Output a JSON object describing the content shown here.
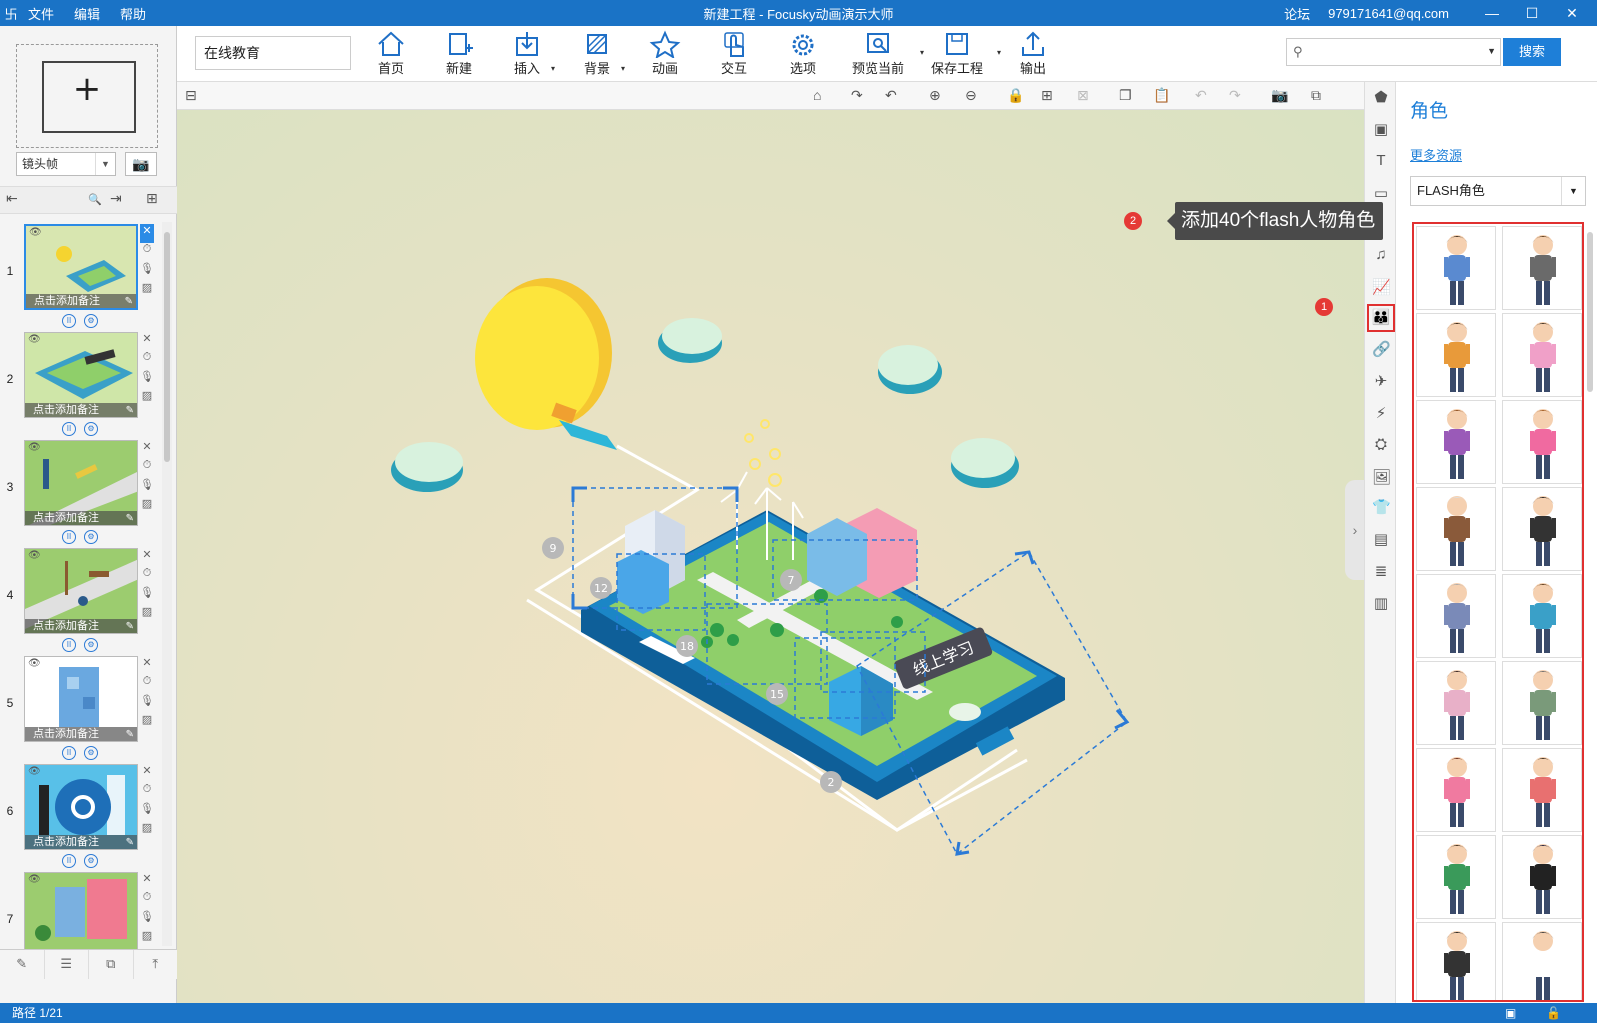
{
  "titlebar": {
    "app_title": "新建工程 - Focusky动画演示大师",
    "menu": [
      "文件",
      "编辑",
      "帮助"
    ],
    "forum": "论坛",
    "user": "979171641@qq.com"
  },
  "left": {
    "frame_select": "镜头帧",
    "slides": [
      {
        "num": "1",
        "note": "点击添加备注"
      },
      {
        "num": "2",
        "note": "点击添加备注"
      },
      {
        "num": "3",
        "note": "点击添加备注"
      },
      {
        "num": "4",
        "note": "点击添加备注"
      },
      {
        "num": "5",
        "note": "点击添加备注"
      },
      {
        "num": "6",
        "note": "点击添加备注"
      },
      {
        "num": "7",
        "note": ""
      }
    ]
  },
  "toolbar": {
    "project_name": "在线教育",
    "buttons": [
      "首页",
      "新建",
      "插入",
      "背景",
      "动画",
      "交互",
      "选项",
      "预览当前",
      "保存工程",
      "输出"
    ],
    "search_button": "搜索"
  },
  "canvas": {
    "badges": [
      "9",
      "12",
      "7",
      "18",
      "15",
      "2"
    ],
    "sign_text": "线上学习"
  },
  "right_panel": {
    "title": "角色",
    "more": "更多资源",
    "select": "FLASH角色"
  },
  "tooltip": {
    "marker1": "1",
    "marker2": "2",
    "text": "添加40个flash人物角色"
  },
  "status": {
    "path": "路径 1/21"
  },
  "colors": {
    "brand_blue": "#1a73c6",
    "highlight_red": "#e03030"
  }
}
